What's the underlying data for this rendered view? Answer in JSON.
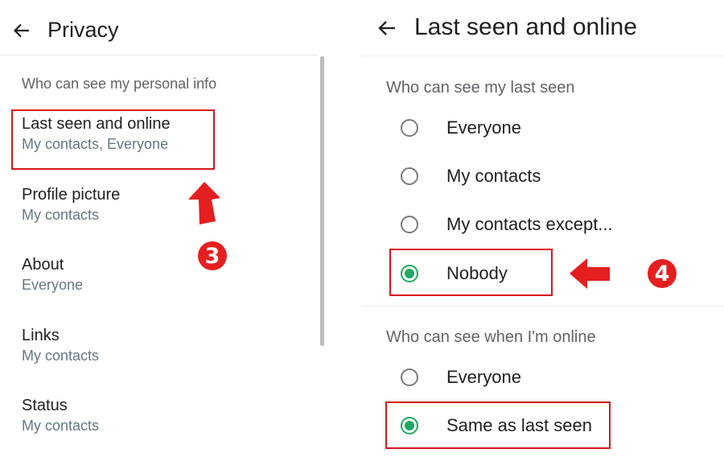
{
  "colors": {
    "accent": "#1daa61",
    "highlight": "#d7191c",
    "badge": "#e51f1f"
  },
  "privacy": {
    "back_icon": "arrow-left-icon",
    "title": "Privacy",
    "section_label": "Who can see my personal info",
    "items": [
      {
        "name": "Last seen and online",
        "value": "My contacts, Everyone"
      },
      {
        "name": "Profile picture",
        "value": "My contacts"
      },
      {
        "name": "About",
        "value": "Everyone"
      },
      {
        "name": "Links",
        "value": "My contacts"
      },
      {
        "name": "Status",
        "value": "My contacts"
      }
    ]
  },
  "last_seen": {
    "back_icon": "arrow-left-icon",
    "title": "Last seen and online",
    "last_seen_group": {
      "label": "Who can see my last seen",
      "options": [
        {
          "label": "Everyone",
          "selected": false
        },
        {
          "label": "My contacts",
          "selected": false
        },
        {
          "label": "My contacts except...",
          "selected": false
        },
        {
          "label": "Nobody",
          "selected": true
        }
      ]
    },
    "online_group": {
      "label": "Who can see when I'm online",
      "options": [
        {
          "label": "Everyone",
          "selected": false
        },
        {
          "label": "Same as last seen",
          "selected": true
        }
      ]
    }
  },
  "annotations": {
    "step3": "3",
    "step4": "4"
  }
}
